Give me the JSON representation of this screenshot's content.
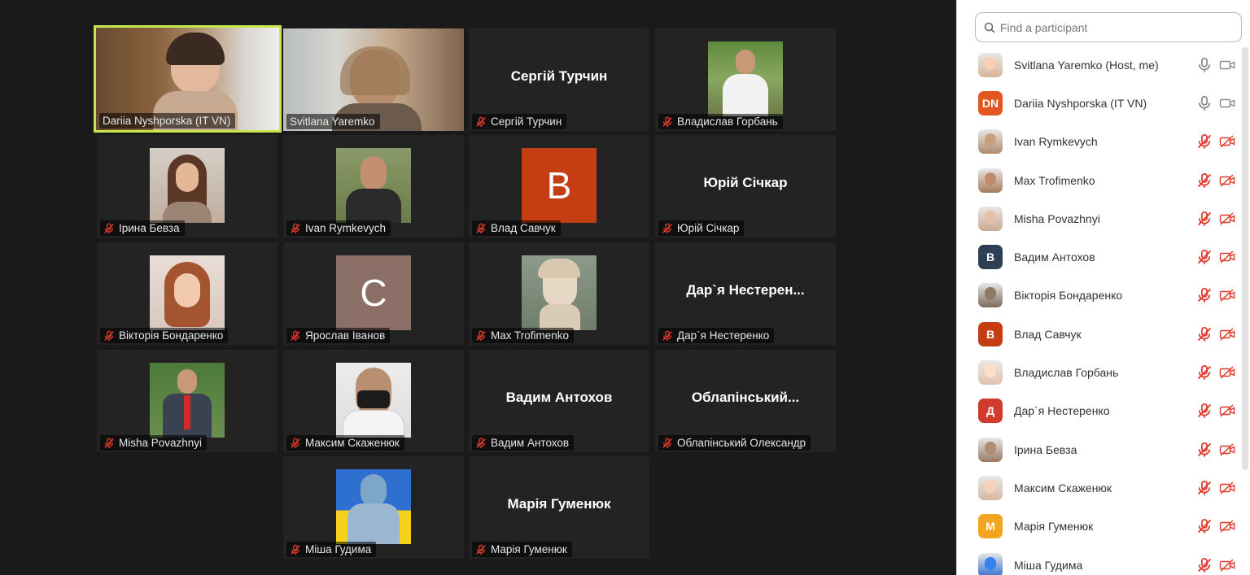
{
  "gallery": {
    "tiles": [
      {
        "name": "Dariia Nyshporska  (IT VN)",
        "kind": "video"
      },
      {
        "name": "Svitlana Yaremko",
        "kind": "video"
      },
      {
        "name": "Сергій Турчин",
        "center": "Сергій Турчин",
        "kind": "name"
      },
      {
        "name": "Владислав Горбань",
        "kind": "photo"
      },
      {
        "name": "Ірина Бевза",
        "kind": "photo"
      },
      {
        "name": "Ivan Rymkevych",
        "kind": "photo"
      },
      {
        "name": "Влад Савчук",
        "kind": "letter",
        "letter": "B",
        "color": "#c53d13"
      },
      {
        "name": "Юрій Січкар",
        "center": "Юрій Січкар",
        "kind": "name"
      },
      {
        "name": "Вікторія Бондаренко",
        "kind": "photo"
      },
      {
        "name": "Ярослав Іванов",
        "kind": "letter",
        "letter": "C",
        "color": "#8c6f66"
      },
      {
        "name": "Max Trofimenko",
        "kind": "photo"
      },
      {
        "name": "Дар`я Нестеренко",
        "center": "Дар`я  Нестерен...",
        "kind": "name"
      },
      {
        "name": "Misha Povazhnyi",
        "kind": "photo"
      },
      {
        "name": "Максим Скаженюк",
        "kind": "photo"
      },
      {
        "name": "Вадим Антохов",
        "center": "Вадим Антохов",
        "kind": "name"
      },
      {
        "name": "Облапінський Олександр",
        "center": "Облапінський...",
        "kind": "name"
      },
      {
        "name": "Міша Гудима",
        "kind": "photo"
      },
      {
        "name": "Марія Гуменюк",
        "center": "Марія Гуменюк",
        "kind": "name"
      }
    ]
  },
  "participants_panel": {
    "search_placeholder": "Find a participant",
    "items": [
      {
        "name": "Svitlana Yaremko (Host, me)",
        "avatar": "photo",
        "muted": false
      },
      {
        "name": "Dariia Nyshporska  (IT VN)",
        "avatar": "DN",
        "color": "#e0571f",
        "muted": false
      },
      {
        "name": "Ivan Rymkevych",
        "avatar": "photo",
        "muted": true
      },
      {
        "name": "Max Trofimenko",
        "avatar": "photo",
        "muted": true
      },
      {
        "name": "Misha Povazhnyi",
        "avatar": "photo",
        "muted": true
      },
      {
        "name": "Вадим Антохов",
        "avatar": "B",
        "color": "#2d3e55",
        "muted": true
      },
      {
        "name": "Вікторія Бондаренко",
        "avatar": "photo",
        "muted": true
      },
      {
        "name": "Влад Савчук",
        "avatar": "B",
        "color": "#c53d13",
        "muted": true
      },
      {
        "name": "Владислав Горбань",
        "avatar": "photo",
        "muted": true
      },
      {
        "name": "Дар`я Нестеренко",
        "avatar": "Д",
        "color": "#d13b2b",
        "muted": true
      },
      {
        "name": "Ірина Бевза",
        "avatar": "photo",
        "muted": true
      },
      {
        "name": "Максим Скаженюк",
        "avatar": "photo",
        "muted": true
      },
      {
        "name": "Марія Гуменюк",
        "avatar": "M",
        "color": "#f2a51f",
        "muted": true
      },
      {
        "name": "Міша Гудима",
        "avatar": "photo",
        "muted": true
      }
    ]
  },
  "colors": {
    "active_speaker": "#c6e84c",
    "muted_red": "#e0392b",
    "panel_bg": "#ffffff",
    "gallery_bg": "#1a1a1a"
  }
}
